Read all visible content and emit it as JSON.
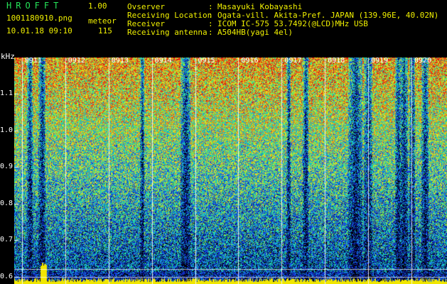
{
  "header": {
    "app_title": "HROFFT",
    "app_version": "1.00",
    "file_name": "1001180910.png",
    "mode": "meteor",
    "datetime": "10.01.18 09:10",
    "count": "115"
  },
  "info": [
    {
      "label": "Ovserver",
      "value": "Masayuki Kobayashi"
    },
    {
      "label": "Receiving Location",
      "value": "Ogata-vill. Akita-Pref. JAPAN (139.96E, 40.02N)"
    },
    {
      "label": "Receiver",
      "value": "ICOM IC-575 53.7492(@LCD)MHz USB"
    },
    {
      "label": "Receiving antenna",
      "value": "A504HB(yagi 4el)"
    }
  ],
  "colors": {
    "background": "#000000",
    "text_yellow": "#f0f000",
    "text_green": "#26e65a",
    "axis_white": "#ffffff"
  },
  "chart_data": {
    "type": "heatmap",
    "ylabel": "kHz",
    "ylim": [
      0.58,
      1.2
    ],
    "y_ticks": [
      "1.1",
      "1.0",
      "0.9",
      "0.8",
      "0.7",
      "0.6"
    ],
    "y_tick_values": [
      1.1,
      1.0,
      0.9,
      0.8,
      0.7,
      0.6
    ],
    "x_ticks": [
      "0911",
      "0912",
      "0913",
      "0914",
      "0915",
      "0916",
      "0917",
      "0918",
      "0919",
      "0920"
    ],
    "x_range_minutes": [
      0,
      10
    ],
    "grid": true,
    "colormap": [
      "#000000",
      "#0a1080",
      "#1438e0",
      "#14a0e0",
      "#20e0a0",
      "#a0e030",
      "#f0e020",
      "#f07010",
      "#e01010"
    ]
  }
}
